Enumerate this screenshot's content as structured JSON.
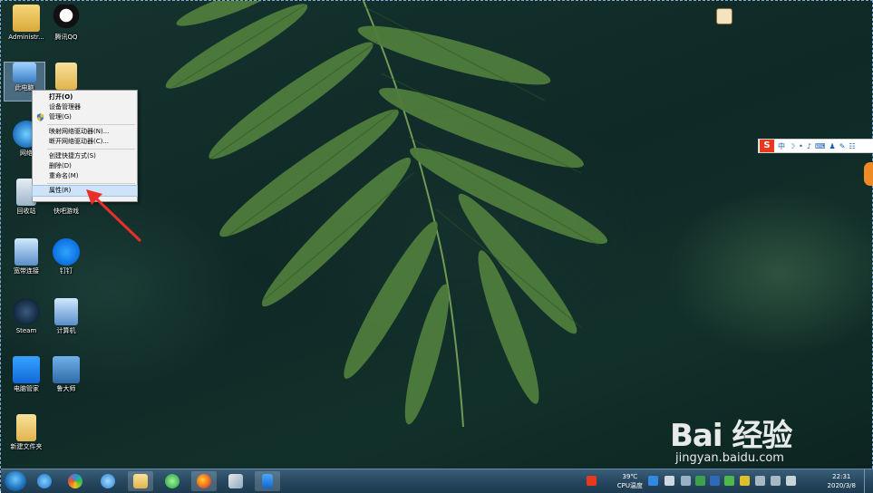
{
  "desktop_icons": [
    {
      "label": "Administr..."
    },
    {
      "label": "腾讯QQ"
    },
    {
      "label": "此电脑"
    },
    {
      "label": ""
    },
    {
      "label": "网络"
    },
    {
      "label": "回收站"
    },
    {
      "label": "快吧游戏"
    },
    {
      "label": "宽带连接"
    },
    {
      "label": "钉钉"
    },
    {
      "label": "Steam"
    },
    {
      "label": "计算机"
    },
    {
      "label": "电脑管家"
    },
    {
      "label": "鲁大师"
    },
    {
      "label": "新建文件夹"
    }
  ],
  "context_menu": {
    "items": [
      {
        "label": "打开(O)"
      },
      {
        "label": "设备管理器"
      },
      {
        "label": "管理(G)"
      },
      {
        "label": "映射网络驱动器(N)..."
      },
      {
        "label": "断开网络驱动器(C)..."
      },
      {
        "label": "创建快捷方式(S)"
      },
      {
        "label": "删除(D)"
      },
      {
        "label": "重命名(M)"
      },
      {
        "label": "属性(R)"
      }
    ]
  },
  "ime_bar": {
    "logo": "S",
    "mode": "中",
    "glyphs": [
      "☽",
      "•",
      "♪",
      "⌨",
      "♟",
      "✎",
      "☷"
    ]
  },
  "taskbar": {
    "apps": [
      "ie-icon",
      "360-browser-icon",
      "internet-explorer-icon",
      "file-explorer-icon",
      "green-browser-icon",
      "firefox-icon",
      "paint-icon",
      "phone-icon"
    ],
    "temperature": "39℃",
    "temperature_label": "CPU温度",
    "time": "22:31",
    "date": "2020/3/8"
  },
  "watermark": {
    "brand": "Bai 经验",
    "url": "jingyan.baidu.com"
  },
  "colors": {
    "menu_highlight": "#cfe3f8",
    "arrow": "#e8302a",
    "ime_logo": "#e8391d"
  }
}
